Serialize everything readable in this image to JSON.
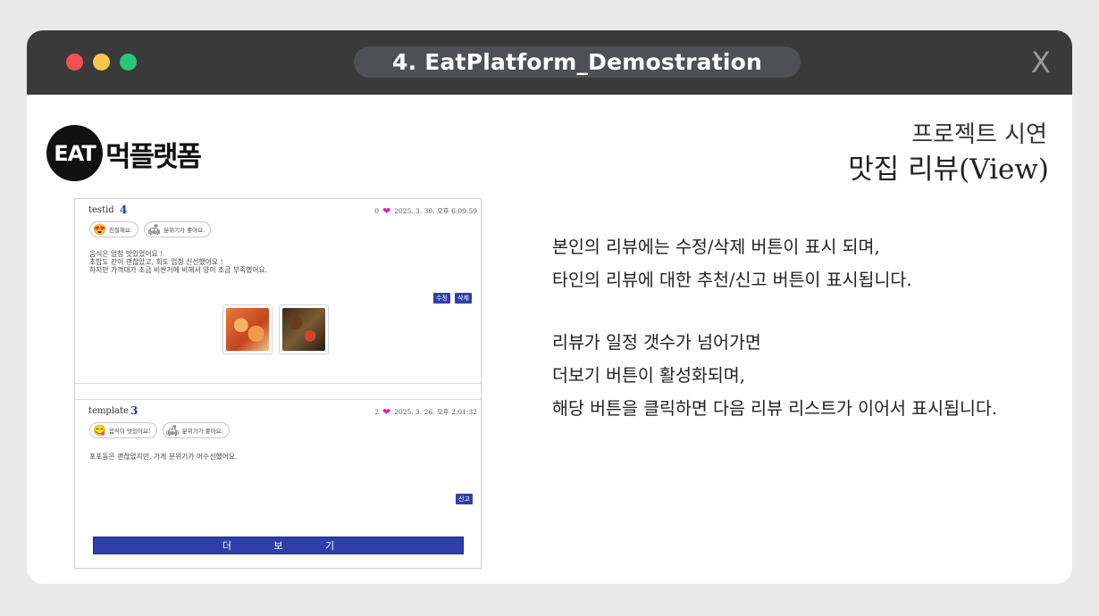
{
  "window": {
    "title": "4. EatPlatform_Demostration",
    "close_label": "X",
    "controls": [
      "close-dot-red",
      "minimize-dot-yellow",
      "maximize-dot-green"
    ]
  },
  "logo": {
    "badge": "EAT",
    "text": "먹플랫폼"
  },
  "heading": {
    "subtitle": "프로젝트 시연",
    "title": "맛집 리뷰(View)"
  },
  "description": {
    "para1": [
      "본인의 리뷰에는 수정/삭제 버튼이 표시 되며,",
      "타인의 리뷰에 대한 추천/신고 버튼이 표시됩니다."
    ],
    "para2": [
      "리뷰가 일정 갯수가 넘어가면",
      "더보기 버튼이 활성화되며,",
      "해당 버튼을 클릭하면 다음 리뷰 리스트가 이어서 표시됩니다."
    ]
  },
  "reviews": [
    {
      "user": "testid",
      "rating": "4",
      "like_count": "0",
      "date": "2025. 3. 30. 오후 6:09:59",
      "tags": [
        {
          "icon": "heart-face-icon",
          "label": "친절해요."
        },
        {
          "icon": "sofa-icon",
          "label": "분위기가 좋아요."
        }
      ],
      "text": [
        "음식은 엄청 맛있었어요 !",
        "초밥도 간이 괜찮았고, 회도 엄청 신선했어요 !",
        "하지만 가격대가 조금 비싼거에 비해서 양이 조금 부족했어요."
      ],
      "buttons": {
        "edit": "수정",
        "delete": "삭제"
      }
    },
    {
      "user": "template",
      "rating": "3",
      "like_count": "2",
      "date": "2025. 3. 26. 오후 2:01:32",
      "tags": [
        {
          "icon": "smile-face-icon",
          "label": "음식이 맛있어요!"
        },
        {
          "icon": "sofa-icon",
          "label": "분위기가 좋아요."
        }
      ],
      "text": [
        "포포동은 괜찮았지만, 가게 분위기가 어수선했어요."
      ],
      "buttons": {
        "report": "신고"
      }
    }
  ],
  "more_button": "더 보 기",
  "colors": {
    "titlebar": "#3a3a3a",
    "accent": "#2e3fa9",
    "heart": "#e020c0"
  }
}
